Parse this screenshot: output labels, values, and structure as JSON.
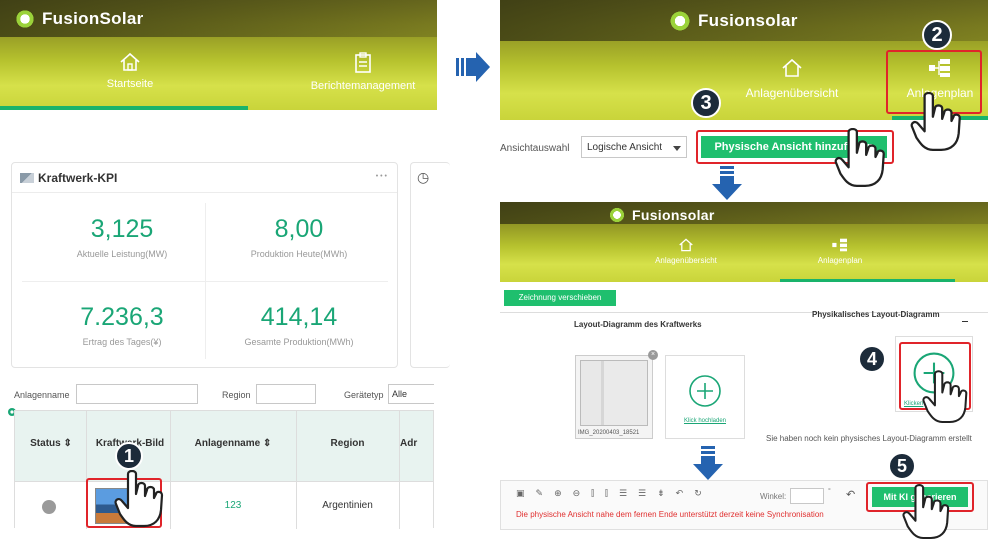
{
  "left": {
    "brand": "FusionSolar",
    "nav": [
      {
        "label": "Startseite",
        "icon": "home-icon"
      },
      {
        "label": "Berichtemanagement",
        "icon": "report-icon"
      }
    ],
    "kpi_card": {
      "title": "Kraftwerk-KPI",
      "more": "• • •",
      "clock_glyph": "◷",
      "values": [
        {
          "value": "3,125",
          "label": "Aktuelle Leistung(MW)"
        },
        {
          "value": "8,00",
          "label": "Produktion Heute(MWh)"
        },
        {
          "value": "7.236,3",
          "label": "Ertrag des Tages(¥)"
        },
        {
          "value": "414,14",
          "label": "Gesamte Produktion(MWh)"
        }
      ]
    },
    "filter": {
      "plant_label": "Anlagenname",
      "region_label": "Region",
      "device_label": "Gerätetyp",
      "device_value": "Alle"
    },
    "table": {
      "headers": [
        "Status ⇕",
        "Kraftwerk-Bild",
        "Anlagenname ⇕",
        "Region",
        "Adr"
      ],
      "row": {
        "name": "123",
        "region": "Argentinien"
      }
    },
    "step1": "1"
  },
  "right_top": {
    "brand": "Fusionsolar",
    "nav": [
      {
        "label": "Anlagenübersicht",
        "icon": "home-icon"
      },
      {
        "label": "Anlagenplan",
        "icon": "layout-plan-icon"
      }
    ],
    "view_label": "Ansichtauswahl",
    "view_value": "Logische Ansicht",
    "add_button": "Physische Ansicht hinzufügen",
    "step2": "2",
    "step3": "3"
  },
  "right_bottom": {
    "brand": "Fusionsolar",
    "nav": [
      {
        "label": "Anlagenübersicht",
        "icon": "home-icon"
      },
      {
        "label": "Anlagenplan",
        "icon": "layout-plan-icon"
      }
    ],
    "move_button": "Zeichnung verschieben",
    "layout_title": "Layout-Diagramm des Kraftwerks",
    "phys_title": "Physikalisches Layout-Diagramm",
    "image_name": "IMG_20200403_18521",
    "upload_link": "Klick hochladen",
    "create_link": "Klicken",
    "no_layout_msg": "Sie haben noch kein physisches Layout-Diagramm erstellt",
    "angle_label": "Winkel:",
    "ai_button": "Mit KI generieren",
    "sync_msg": "Die physische Ansicht nahe dem fernen Ende unterstützt derzeit keine Synchronisation",
    "step4": "4",
    "step5": "5"
  }
}
